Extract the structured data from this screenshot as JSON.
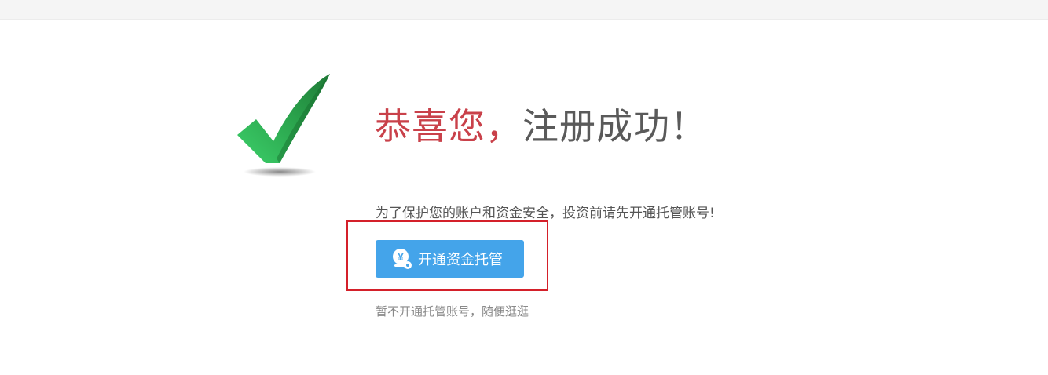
{
  "header": {
    "strip_color": "#f5f5f5"
  },
  "success": {
    "icon": "checkmark-icon",
    "title_highlight": "恭喜您，",
    "title_rest": "注册成功！",
    "highlight_color": "#c9414a",
    "rest_color": "#5a5a5a"
  },
  "notice": {
    "text": "为了保护您的账户和资金安全，投资前请先开通托管账号!"
  },
  "actions": {
    "open_button": {
      "label": "开通资金托管",
      "icon": "yuan-gear-icon",
      "color": "#44a4ea"
    },
    "skip_link": "暂不开通托管账号，随便逛逛"
  },
  "annotation": {
    "box_color": "#d4202a"
  }
}
